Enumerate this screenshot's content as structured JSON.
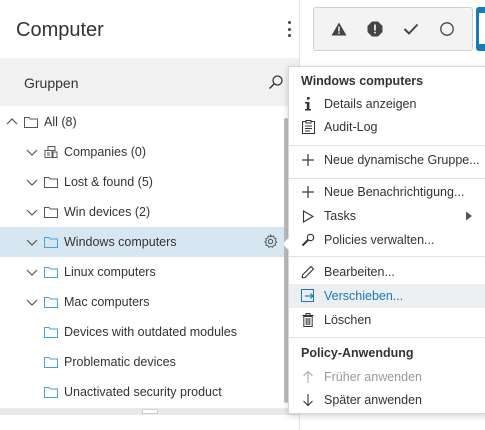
{
  "header": {
    "title": "Computer"
  },
  "groups": {
    "label": "Gruppen"
  },
  "tree": [
    {
      "label": "All (8)",
      "expanded": true,
      "icon": "folder-icon"
    },
    {
      "label": "Companies (0)",
      "expanded": true,
      "icon": "companies-icon"
    },
    {
      "label": "Lost & found (5)",
      "expanded": true,
      "icon": "folder-icon"
    },
    {
      "label": "Win devices (2)",
      "expanded": true,
      "icon": "folder-icon"
    },
    {
      "label": "Windows computers",
      "expanded": true,
      "icon": "smart-folder-icon",
      "selected": true
    },
    {
      "label": "Linux computers",
      "expanded": true,
      "icon": "smart-folder-icon"
    },
    {
      "label": "Mac computers",
      "expanded": true,
      "icon": "smart-folder-icon"
    },
    {
      "label": "Devices with outdated modules",
      "icon": "smart-folder-icon"
    },
    {
      "label": "Problematic devices",
      "icon": "smart-folder-icon"
    },
    {
      "label": "Unactivated security product",
      "icon": "smart-folder-icon"
    }
  ],
  "toolbar": {
    "buttons": [
      "warning-triangle-icon",
      "alert-circle-icon",
      "checkmark-icon",
      "circle-outline-icon"
    ]
  },
  "menu": {
    "header": "Windows computers",
    "items": [
      {
        "label": "Details anzeigen",
        "icon": "info-icon"
      },
      {
        "label": "Audit-Log",
        "icon": "clipboard-icon"
      },
      {
        "label": "Neue dynamische Gruppe...",
        "icon": "plus-icon"
      },
      {
        "label": "Neue Benachrichtigung...",
        "icon": "plus-icon"
      },
      {
        "label": "Tasks",
        "icon": "play-outline-icon"
      },
      {
        "label": "Policies verwalten...",
        "icon": "wrench-icon"
      },
      {
        "label": "Bearbeiten...",
        "icon": "pencil-icon"
      },
      {
        "label": "Verschieben...",
        "icon": "move-icon",
        "highlighted": true
      },
      {
        "label": "Löschen",
        "icon": "trash-icon"
      },
      {
        "label": "Früher anwenden",
        "icon": "arrow-up-icon",
        "disabled": true
      },
      {
        "label": "Später anwenden",
        "icon": "arrow-down-icon"
      }
    ],
    "policy_header": "Policy-Anwendung"
  },
  "colors": {
    "accent": "#1a7ab8",
    "selected_row": "#d7e7f1",
    "folder": "#4a9fd8"
  }
}
